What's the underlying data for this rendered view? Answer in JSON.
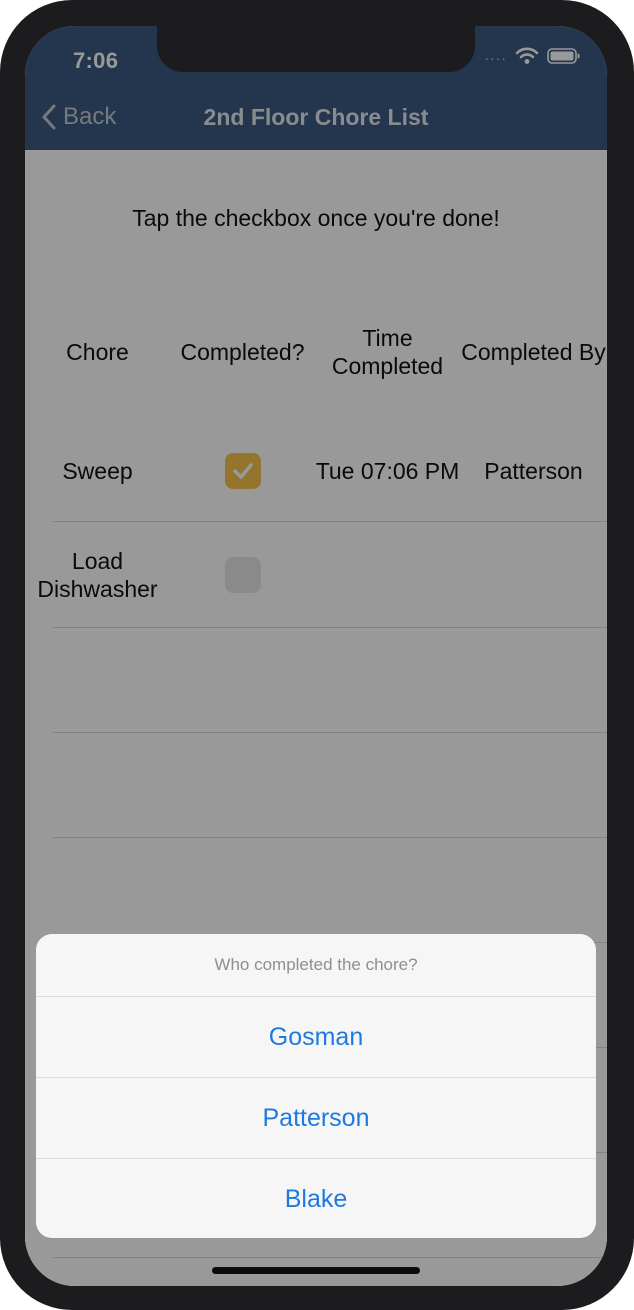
{
  "status": {
    "time": "7:06"
  },
  "nav": {
    "back_label": "Back",
    "title": "2nd Floor Chore List"
  },
  "instruction": "Tap the checkbox once you're done!",
  "table": {
    "headers": [
      "Chore",
      "Completed?",
      "Time Completed",
      "Completed By"
    ],
    "rows": [
      {
        "chore": "Sweep",
        "completed": true,
        "time": "Tue 07:06 PM",
        "by": "Patterson"
      },
      {
        "chore": "Load Dishwasher",
        "completed": false,
        "time": "",
        "by": ""
      }
    ]
  },
  "action_sheet": {
    "title": "Who completed the chore?",
    "options": [
      "Gosman",
      "Patterson",
      "Blake"
    ]
  },
  "colors": {
    "nav_bar": "#3d5a80",
    "checkbox_checked": "#f5c44c",
    "action_text": "#1f7ae0"
  },
  "icons": [
    "back-chevron-icon",
    "wifi-icon",
    "battery-icon",
    "checkmark-icon"
  ]
}
